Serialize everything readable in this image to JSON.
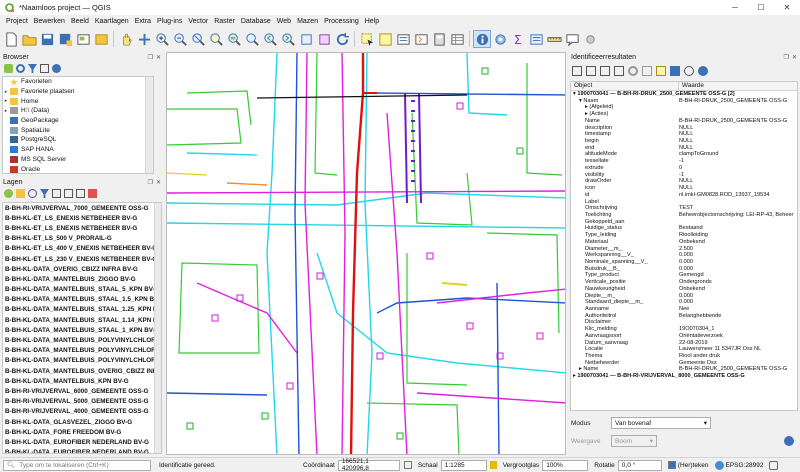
{
  "window": {
    "title": "*Naamloos project — QGIS"
  },
  "menu": [
    "Project",
    "Bewerken",
    "Beeld",
    "Kaartlagen",
    "Extra",
    "Plug-ins",
    "Vector",
    "Raster",
    "Database",
    "Web",
    "Mazen",
    "Processing",
    "Help"
  ],
  "toolbar_icons": [
    "new-project-icon",
    "open-project-icon",
    "save-project-icon",
    "save-as-icon",
    "open-layout-icon",
    "layout-manager-icon",
    "pan-icon",
    "pan-to-selection-icon",
    "zoom-in-icon",
    "zoom-out-icon",
    "zoom-full-icon",
    "zoom-selection-icon",
    "zoom-layer-icon",
    "zoom-native-icon",
    "zoom-last-icon",
    "zoom-next-icon",
    "new-bookmark-icon",
    "show-bookmarks-icon",
    "refresh-icon",
    "select-feature-icon",
    "deselect-icon",
    "select-by-value-icon",
    "select-by-expression-icon",
    "field-calculator-icon",
    "open-attribute-table-icon",
    "identify-icon",
    "settings-icon",
    "sum-icon",
    "attribute-icon",
    "measure-icon",
    "annotation-icon",
    "label-icon"
  ],
  "browser": {
    "title": "Browser",
    "items": [
      {
        "label": "Favorieten",
        "arrow": "",
        "icon": "star-icon"
      },
      {
        "label": "Favoriete plaatsen",
        "arrow": "▸",
        "icon": "folder-icon"
      },
      {
        "label": "Home",
        "arrow": "▸",
        "icon": "folder-icon"
      },
      {
        "label": "H:\\ (Data)",
        "arrow": "▸",
        "icon": "drive-icon"
      },
      {
        "label": "GeoPackage",
        "arrow": "",
        "icon": "geopackage-icon"
      },
      {
        "label": "SpatiaLite",
        "arrow": "",
        "icon": "spatialite-icon"
      },
      {
        "label": "PostgreSQL",
        "arrow": "",
        "icon": "postgresql-icon"
      },
      {
        "label": "SAP HANA",
        "arrow": "",
        "icon": "database-icon"
      },
      {
        "label": "MS SQL Server",
        "arrow": "",
        "icon": "database-icon"
      },
      {
        "label": "Oracle",
        "arrow": "",
        "icon": "database-icon"
      }
    ]
  },
  "layers": {
    "title": "Lagen",
    "items": [
      "B-BH-RI-VRIJVERVAL_7000_GEMEENTE OSS-G",
      "B-BH-KL-ET_LS_ENEXIS NETBEHEER BV-G",
      "B-BH-KL-ET_LS_ENEXIS NETBEHEER BV-G",
      "B-BH-KL-ET_LS_500 V_PRORAIL-G",
      "B-BH-KL-ET_LS_400 V_ENEXIS NETBEHEER BV-G",
      "B-BH-KL-ET_LS_230 V_ENEXIS NETBEHEER BV-G",
      "B-BH-KL-DATA_OVERIG_CBIZZ INFRA BV-G",
      "B-BH-KL-DATA_MANTELBUIS_ZIGGO BV-G",
      "B-BH-KL-DATA_MANTELBUIS_STAAL_5_KPN BV-G",
      "B-BH-KL-DATA_MANTELBUIS_STAAL_1.5_KPN BV-G",
      "B-BH-KL-DATA_MANTELBUIS_STAAL_1.25_KPN BV-G",
      "B-BH-KL-DATA_MANTELBUIS_STAAL_1.14_KPN BV-G",
      "B-BH-KL-DATA_MANTELBUIS_STAAL_1_KPN BV-G",
      "B-BH-KL-DATA_MANTELBUIS_POLYVINYLCHLORIDE",
      "B-BH-KL-DATA_MANTELBUIS_POLYVINYLCHLORIDE",
      "B-BH-KL-DATA_MANTELBUIS_POLYVINYLCHLORIDE",
      "B-BH-KL-DATA_MANTELBUIS_OVERIG_CBIZZ INFRA",
      "B-BH-KL-DATA_MANTELBUIS_KPN BV-G",
      "B-BH-RI-VRIJVERVAL_6000_GEMEENTE OSS-G",
      "B-BH-RI-VRIJVERVAL_5000_GEMEENTE OSS-G",
      "B-BH-RI-VRIJVERVAL_4000_GEMEENTE OSS-G",
      "B-BH-KL-DATA_GLASVEZEL_ZIGGO BV-G",
      "B-BH-KL-DATA_FORE FREEDOM BV-G",
      "B-BH-KL-DATA_EUROFIBER NEDERLAND BV-G",
      "B-BH-KL-DATA_EUROFIBER NEDERLAND BV-G"
    ]
  },
  "identify": {
    "title": "Identificeerresultaten",
    "col_object": "Object",
    "col_value": "Waarde",
    "rows": [
      {
        "k": "▾ 1900703041 — B-BH-RI-DRUK_2500_GEMEENTE OSS-G [2]",
        "v": "",
        "feat": true,
        "indent": 0
      },
      {
        "k": "▾ Naam",
        "v": "B-BH-RI-DRUK_2500_GEMEENTE OSS-G",
        "indent": 1
      },
      {
        "k": "▸ (Afgeleid)",
        "v": "",
        "indent": 2
      },
      {
        "k": "▸ (Acties)",
        "v": "",
        "indent": 2
      },
      {
        "k": "Name",
        "v": "B-BH-RI-DRUK_2500_GEMEENTE OSS-G",
        "indent": 2
      },
      {
        "k": "description",
        "v": "NULL",
        "indent": 2
      },
      {
        "k": "timestamp",
        "v": "NULL",
        "indent": 2
      },
      {
        "k": "begin",
        "v": "NULL",
        "indent": 2
      },
      {
        "k": "end",
        "v": "NULL",
        "indent": 2
      },
      {
        "k": "altitudeMode",
        "v": "clampToGround",
        "indent": 2
      },
      {
        "k": "tessellate",
        "v": "-1",
        "indent": 2
      },
      {
        "k": "extrude",
        "v": "0",
        "indent": 2
      },
      {
        "k": "visibility",
        "v": "-1",
        "indent": 2
      },
      {
        "k": "drawOrder",
        "v": "NULL",
        "indent": 2
      },
      {
        "k": "icon",
        "v": "NULL",
        "indent": 2
      },
      {
        "k": "id",
        "v": "nl.imkl-GM0828.ROD_13937_19534",
        "indent": 2
      },
      {
        "k": "Label",
        "v": "",
        "indent": 2
      },
      {
        "k": "Omschrijving",
        "v": "TEST",
        "indent": 2
      },
      {
        "k": "Toelichting",
        "v": "Beheerobjectomschrijving: LEI-RP-43, Beheer",
        "indent": 2
      },
      {
        "k": "Gekoppeld_aan",
        "v": "",
        "indent": 2
      },
      {
        "k": "Huidige_status",
        "v": "Bestaand",
        "indent": 2
      },
      {
        "k": "Type_leiding",
        "v": "Rioolleiding",
        "indent": 2
      },
      {
        "k": "Materiaal",
        "v": "Onbekend",
        "indent": 2
      },
      {
        "k": "Diameter__m_",
        "v": "2.500",
        "indent": 2
      },
      {
        "k": "Werkspanning__V_",
        "v": "0.000",
        "indent": 2
      },
      {
        "k": "Nominale_spanning__V_",
        "v": "0.000",
        "indent": 2
      },
      {
        "k": "Buisdruk__B_",
        "v": "0.000",
        "indent": 2
      },
      {
        "k": "Type_product",
        "v": "Gemengd",
        "indent": 2
      },
      {
        "k": "Verticale_positie",
        "v": "Ondergronds",
        "indent": 2
      },
      {
        "k": "Nauwkeurigheid",
        "v": "Onbekend",
        "indent": 2
      },
      {
        "k": "Diepte__m_",
        "v": "0.000",
        "indent": 2
      },
      {
        "k": "Standaard_diepte__m_",
        "v": "0.000",
        "indent": 2
      },
      {
        "k": "Aanname",
        "v": "Nee",
        "indent": 2
      },
      {
        "k": "Authoriteitrol",
        "v": "Belanghebbende",
        "indent": 2
      },
      {
        "k": "Disclaimer",
        "v": "",
        "indent": 2
      },
      {
        "k": "Klic_melding",
        "v": "19O070304_1",
        "indent": 2
      },
      {
        "k": "Aanvraagsoort",
        "v": "Oriëntatieverzoek",
        "indent": 2
      },
      {
        "k": "Datum_aanvraag",
        "v": "22-08-2019",
        "indent": 2
      },
      {
        "k": "Locatie",
        "v": "Lauwersmeer 11 5347JR Oss NL",
        "indent": 2
      },
      {
        "k": "Thema",
        "v": "Riool ander druk",
        "indent": 2
      },
      {
        "k": "Netbeheerder",
        "v": "Gemeente Oss",
        "indent": 2
      },
      {
        "k": "▸ Name",
        "v": "B-BH-RI-DRUK_2500_GEMEENTE OSS-G",
        "indent": 1
      },
      {
        "k": "▸ 1900703041 — B-BH-RI-VRIJVERVAL_8000_GEMEENTE OSS-G",
        "v": "",
        "feat": true,
        "indent": 0
      }
    ],
    "modus_label": "Modus",
    "modus_value": "Van bovenaf",
    "weergave_label": "Weergave",
    "weergave_value": "Boom"
  },
  "status": {
    "search_placeholder": "Type om te lokaliseren (Ctrl+K)",
    "message": "Identificatie gereed.",
    "coord_label": "Coördinaat",
    "coord_value": "166521,1  420996,8",
    "scale_label": "Schaal",
    "scale_value": "1:1285",
    "magnifier_label": "Vergrootglas",
    "magnifier_value": "100%",
    "rotation_label": "Rotatie",
    "rotation_value": "0,0 °",
    "render_label": "(Her)teken",
    "crs_label": "EPSG:28992"
  }
}
